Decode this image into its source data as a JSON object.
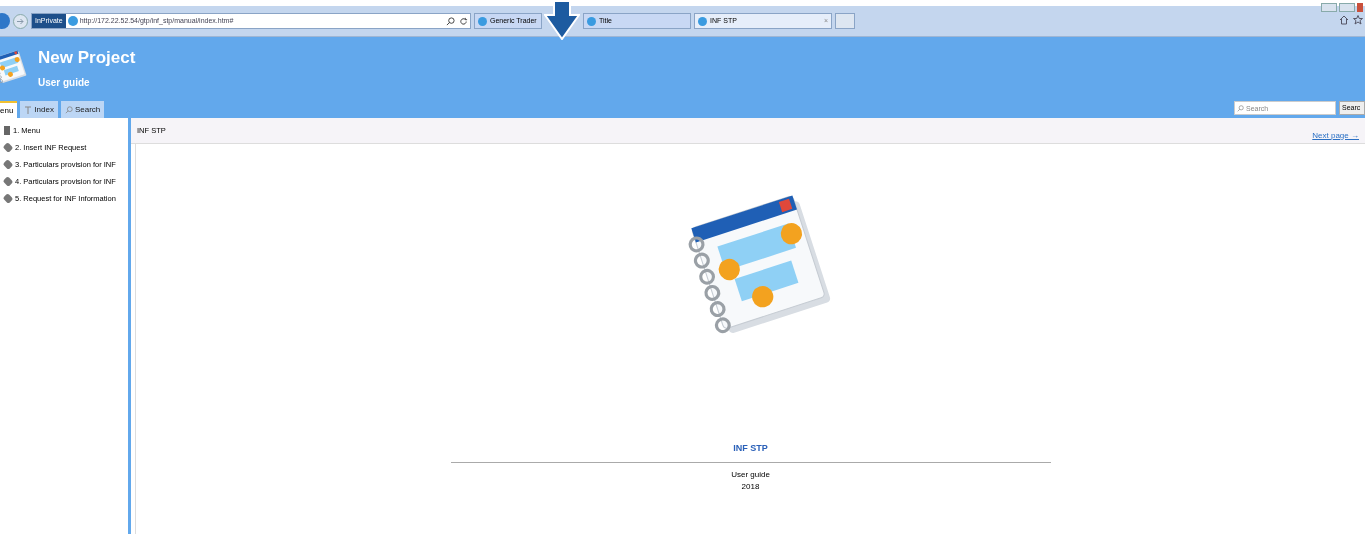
{
  "browser": {
    "private_badge": "InPrivate",
    "address": "http://172.22.52.54/gtp/inf_stp/manual/index.htm#",
    "tabs": [
      {
        "label": "Generic Trader",
        "selected": false
      },
      {
        "label": "Title",
        "selected": false
      },
      {
        "label": "INF STP",
        "selected": true,
        "close": "×"
      }
    ]
  },
  "header": {
    "title": "New Project",
    "subtitle": "User guide",
    "search_placeholder": "Search",
    "search_button": "Searc"
  },
  "sidebar": {
    "tabs": [
      {
        "label": "enu",
        "selected": true
      },
      {
        "label": "Index",
        "selected": false
      },
      {
        "label": "Search",
        "selected": false
      }
    ],
    "items": [
      {
        "label": "1. Menu",
        "kind": "book"
      },
      {
        "label": "2. Insert INF Request",
        "kind": "page"
      },
      {
        "label": "3. Particulars provision for INF",
        "kind": "page"
      },
      {
        "label": "4. Particulars provision for INF",
        "kind": "page"
      },
      {
        "label": "5. Request for INF Information",
        "kind": "page"
      }
    ]
  },
  "content": {
    "breadcrumb": "INF STP",
    "next_link": "Next page →",
    "title": "INF STP",
    "subtitle": "User guide",
    "year": "2018"
  }
}
